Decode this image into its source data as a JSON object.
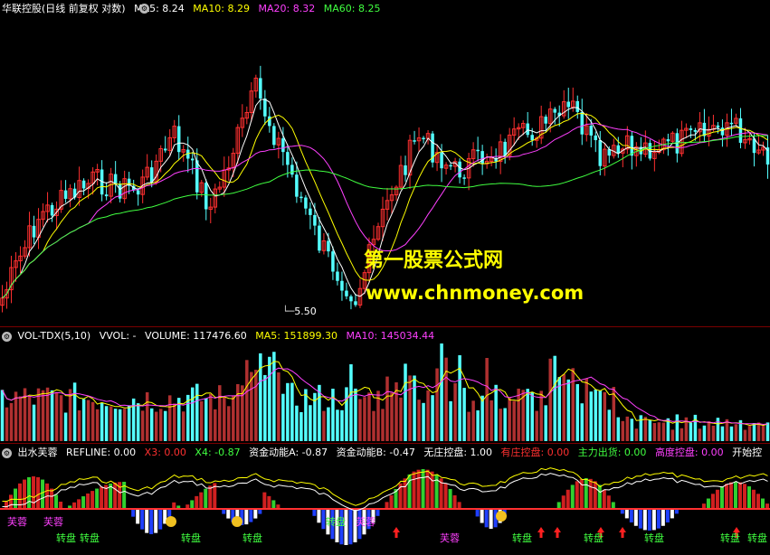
{
  "main": {
    "title": "华联控股(日线 前复权 对数)",
    "ma": [
      {
        "label": "MA5: 8.24",
        "color": "#ffffff"
      },
      {
        "label": "MA10: 8.29",
        "color": "#ffff00"
      },
      {
        "label": "MA20: 8.32",
        "color": "#ff40ff"
      },
      {
        "label": "MA60: 8.25",
        "color": "#40ff40"
      }
    ],
    "low_label": "5.50",
    "watermark_cn": "第一股票公式网",
    "watermark_url": "www.chnmoney.com"
  },
  "volume": {
    "title": "VOL-TDX(5,10)",
    "vvol": "VVOL: -",
    "items": [
      {
        "label": "VOLUME: 117476.60",
        "color": "#ffffff"
      },
      {
        "label": "MA5: 151899.30",
        "color": "#ffff00"
      },
      {
        "label": "MA10: 145034.44",
        "color": "#ff40ff"
      }
    ]
  },
  "indicator": {
    "title": "出水芙蓉",
    "items": [
      {
        "label": "REFLINE: 0.00",
        "color": "#ffffff"
      },
      {
        "label": "X3: 0.00",
        "color": "#ff3030"
      },
      {
        "label": "X4: -0.87",
        "color": "#40ff40"
      },
      {
        "label": "资金动能A: -0.87",
        "color": "#ffffff"
      },
      {
        "label": "资金动能B: -0.47",
        "color": "#ffffff"
      },
      {
        "label": "无庄控盘: 1.00",
        "color": "#ffffff"
      },
      {
        "label": "有庄控盘: 0.00",
        "color": "#ff3030"
      },
      {
        "label": "主力出货: 0.00",
        "color": "#40ff40"
      },
      {
        "label": "高度控盘: 0.00",
        "color": "#ff40ff"
      },
      {
        "label": "开始控",
        "color": "#ffffff"
      }
    ],
    "labels": [
      {
        "text": "芙蓉",
        "color": "#ff40ff"
      },
      {
        "text": "芙蓉",
        "color": "#ff40ff"
      },
      {
        "text": "转盘",
        "color": "#40ff40"
      },
      {
        "text": "转盘",
        "color": "#40ff40"
      },
      {
        "text": "转盘",
        "color": "#40ff40"
      },
      {
        "text": "转盘",
        "color": "#40ff40"
      },
      {
        "text": "芙蓉",
        "color": "#ff40ff"
      },
      {
        "text": "芙蓉",
        "color": "#ff40ff"
      },
      {
        "text": "转盘",
        "color": "#40ff40"
      },
      {
        "text": "转盘",
        "color": "#40ff40"
      },
      {
        "text": "转盘",
        "color": "#40ff40"
      },
      {
        "text": "转盘",
        "color": "#40ff40"
      },
      {
        "text": "转盘",
        "color": "#40ff40"
      },
      {
        "text": "转盘",
        "color": "#40ff40"
      }
    ]
  },
  "colors": {
    "up": "#ff3030",
    "down": "#54ffff",
    "border": "#7a0000"
  }
}
